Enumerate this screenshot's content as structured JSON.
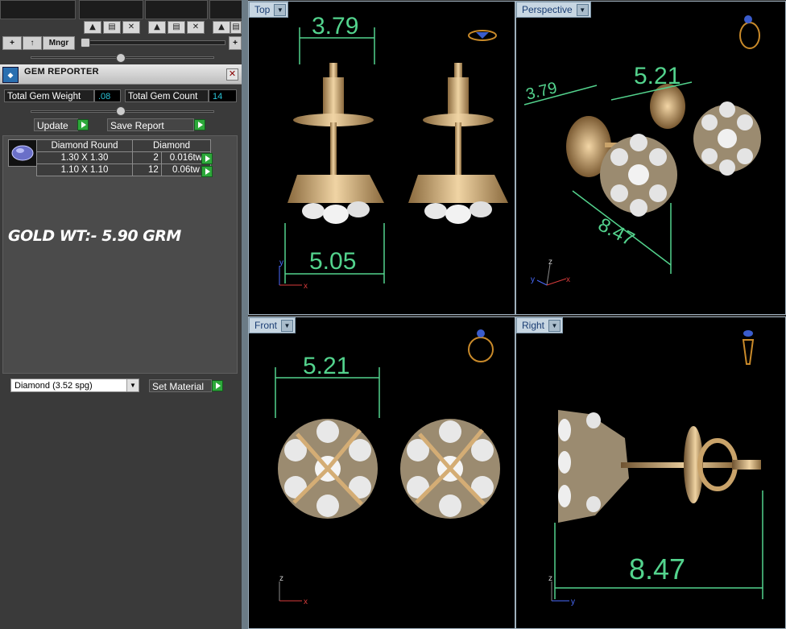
{
  "toolbar": {
    "add_symbol": "+",
    "up_symbol": "↑",
    "manager_label": "Mngr",
    "plus_right": "+"
  },
  "gem_reporter": {
    "title": "GEM REPORTER",
    "close_symbol": "✕",
    "total_weight_label": "Total Gem Weight",
    "total_weight_value": ".08",
    "total_count_label": "Total Gem Count",
    "total_count_value": "14",
    "update_label": "Update",
    "save_report_label": "Save Report",
    "table": {
      "headers": [
        "Diamond Round",
        "Diamond"
      ],
      "rows": [
        {
          "size": "1.30 X 1.30",
          "count": "2",
          "weight": "0.016tw"
        },
        {
          "size": "1.10 X 1.10",
          "count": "12",
          "weight": "0.06tw"
        }
      ]
    },
    "note": "GOLD WT:- 5.90 GRM",
    "material_select": "Diamond    (3.52 spg)",
    "set_material_label": "Set Material"
  },
  "viewports": {
    "top": {
      "label": "Top",
      "dims": [
        "3.79",
        "5.05"
      ],
      "axes": [
        "y",
        "x"
      ]
    },
    "perspective": {
      "label": "Perspective",
      "dims": [
        "5.21",
        "3.79",
        "8.47"
      ],
      "axes": [
        "z",
        "y",
        "x"
      ]
    },
    "front": {
      "label": "Front",
      "dims": [
        "5.21"
      ],
      "axes": [
        "z",
        "x"
      ]
    },
    "right": {
      "label": "Right",
      "dims": [
        "8.47"
      ],
      "axes": [
        "z",
        "y"
      ]
    }
  },
  "colors": {
    "dimension": "#53d38d",
    "gold": "#c9a36a",
    "viewport_bg": "#000000",
    "tab": "#c7d6e2"
  }
}
